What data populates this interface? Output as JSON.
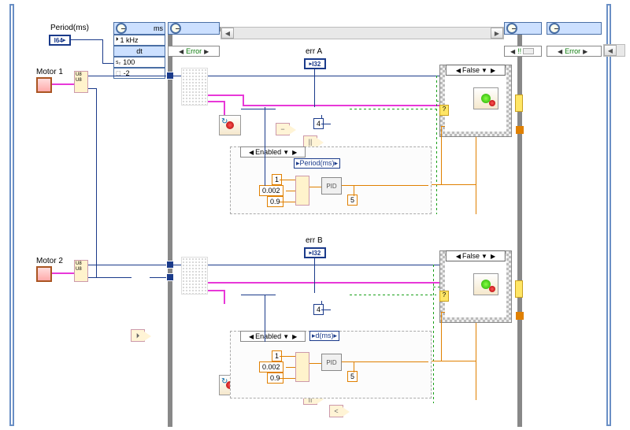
{
  "inputs": {
    "period_label": "Period(ms)",
    "period_type": "I64",
    "motor1_label": "Motor 1",
    "motor2_label": "Motor 2"
  },
  "timed_loop": {
    "units": "ms",
    "source": "1 kHz",
    "dt_label": "dt",
    "dt_value": "100",
    "priority": "-2",
    "error_case": "Error",
    "right_error_case": "Error",
    "right_gap": "!!"
  },
  "motorA": {
    "err_label": "err A",
    "err_type": "I32",
    "compare_const": "4",
    "case_value": "False",
    "disabled_tab": "Enabled",
    "period_label": "Period(ms)",
    "pid_label": "PID",
    "pid_kp": "1",
    "pid_ki": "0.002",
    "pid_kd": "0.9",
    "pid_out_const": "5"
  },
  "motorB": {
    "err_label": "err B",
    "err_type": "I32",
    "compare_const": "4",
    "case_value": "False",
    "disabled_tab": "Enabled",
    "period_short": "d(ms)",
    "pid_label": "PID",
    "pid_kp": "1",
    "pid_ki": "0.002",
    "pid_kd": "0.9",
    "pid_out_const": "5"
  },
  "bundle": {
    "u8a": "U8",
    "u8b": "U8"
  }
}
